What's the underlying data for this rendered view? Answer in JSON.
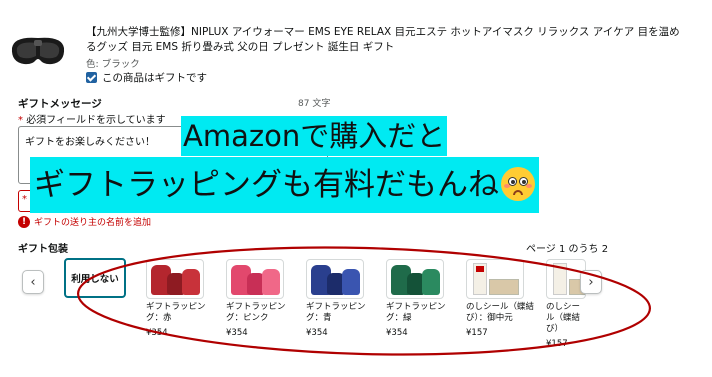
{
  "product": {
    "title": "【九州大学博士監修】NIPLUX アイウォーマー EMS EYE RELAX 目元エステ ホットアイマスク リラックス アイケア 目を温めるグッズ 目元 EMS 折り畳み式 父の日 プレゼント 誕生日 ギフト",
    "color": "色: ブラック",
    "gift_checkbox_label": "この商品はギフトです"
  },
  "gift_message": {
    "heading": "ギフトメッセージ",
    "char_count": "87 文字",
    "required_note": "必須フィールドを示しています",
    "message_value": "ギフトをお楽しみください！",
    "sender_star": "*",
    "error_text": "ギフトの送り主の名前を追加"
  },
  "gift_wrap": {
    "heading": "ギフト包装",
    "page_indicator": "ページ 1 のうち 2",
    "prev_label": "‹",
    "next_label": "›",
    "no_wrap_label": "利用しない",
    "options": [
      {
        "label": "ギフトラッピング：赤",
        "price": "¥354"
      },
      {
        "label": "ギフトラッピング：ピンク",
        "price": "¥354"
      },
      {
        "label": "ギフトラッピング：青",
        "price": "¥354"
      },
      {
        "label": "ギフトラッピング：緑",
        "price": "¥354"
      },
      {
        "label": "のしシール（蝶結び）：御中元",
        "price": "¥157"
      },
      {
        "label": "のしシール（蝶結び）",
        "price": "¥157"
      }
    ]
  },
  "overlay": {
    "line1": "Amazonで購入だと",
    "line2": "ギフトラッピングも有料だもんね",
    "emoji": "flushed-face-icon"
  },
  "colors": {
    "banner": "#00eaf2",
    "ellipse": "#b00000",
    "selected_border": "#007185",
    "error": "#c40000",
    "checkbox": "#2162a1"
  }
}
